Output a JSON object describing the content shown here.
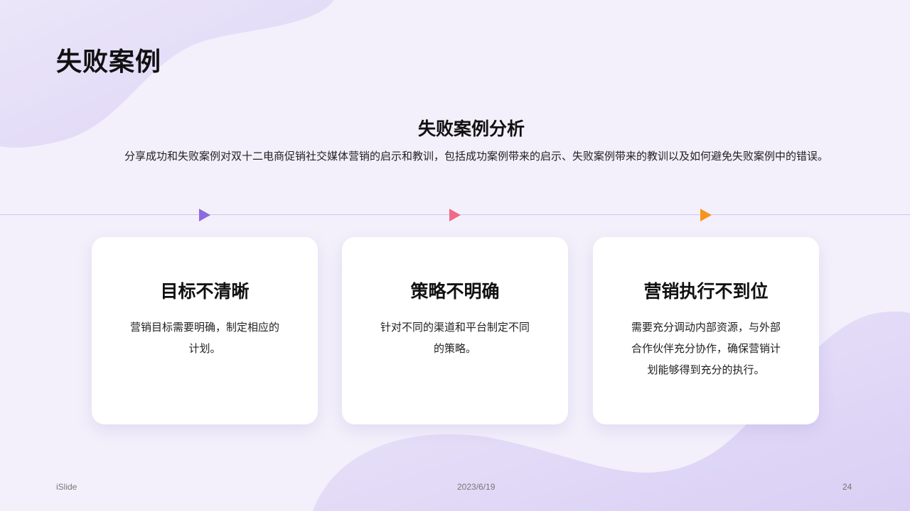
{
  "title": "失败案例",
  "section": {
    "heading": "失败案例分析",
    "description": "分享成功和失败案例对双十二电商促销社交媒体营销的启示和教训，包括成功案例带来的启示、失败案例带来的教训以及如何避免失败案例中的错误。"
  },
  "colors": {
    "background": "#f3f0fb",
    "accent_purple": "#8b6ae0",
    "accent_pink": "#f06a85",
    "accent_orange": "#f5941e"
  },
  "markers": [
    {
      "color": "#8b6ae0"
    },
    {
      "color": "#f06a85"
    },
    {
      "color": "#f5941e"
    }
  ],
  "cards": [
    {
      "title": "目标不清晰",
      "text": "营销目标需要明确，制定相应的计划。"
    },
    {
      "title": "策略不明确",
      "text": "针对不同的渠道和平台制定不同的策略。"
    },
    {
      "title": "营销执行不到位",
      "text": "需要充分调动内部资源，与外部合作伙伴充分协作，确保营销计划能够得到充分的执行。"
    }
  ],
  "footer": {
    "brand": "iSlide",
    "date": "2023/6/19",
    "page_number": "24"
  }
}
